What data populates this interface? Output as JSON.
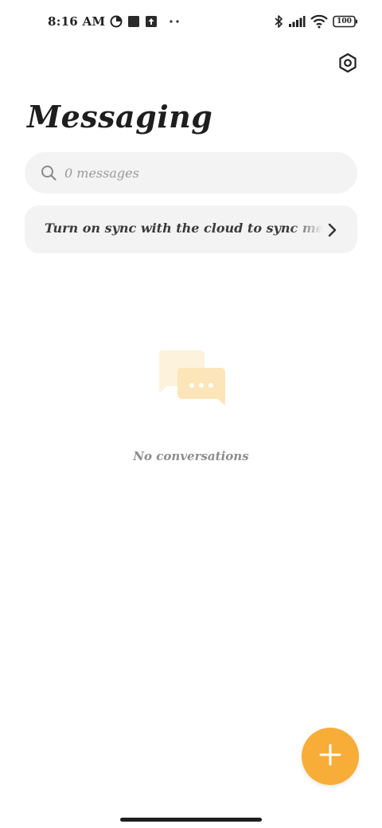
{
  "status_bar": {
    "time": "8:16 AM",
    "battery": "100",
    "icons": [
      "data-saver-icon",
      "square-notification-icon",
      "upload-notification-icon",
      "more-dots-icon",
      "bluetooth-icon",
      "signal-icon",
      "wifi-icon",
      "battery-icon"
    ]
  },
  "header": {
    "title": "Messaging",
    "settings_icon": "settings-hexagon-icon"
  },
  "search": {
    "placeholder": "0 messages"
  },
  "sync_banner": {
    "text": "Turn on sync with the cloud to sync messages"
  },
  "empty_state": {
    "text": "No conversations"
  },
  "colors": {
    "accent": "#f7ad38",
    "surface": "#f3f3f3",
    "illustration_back": "#fdf2dc",
    "illustration_front": "#fce4b4"
  }
}
